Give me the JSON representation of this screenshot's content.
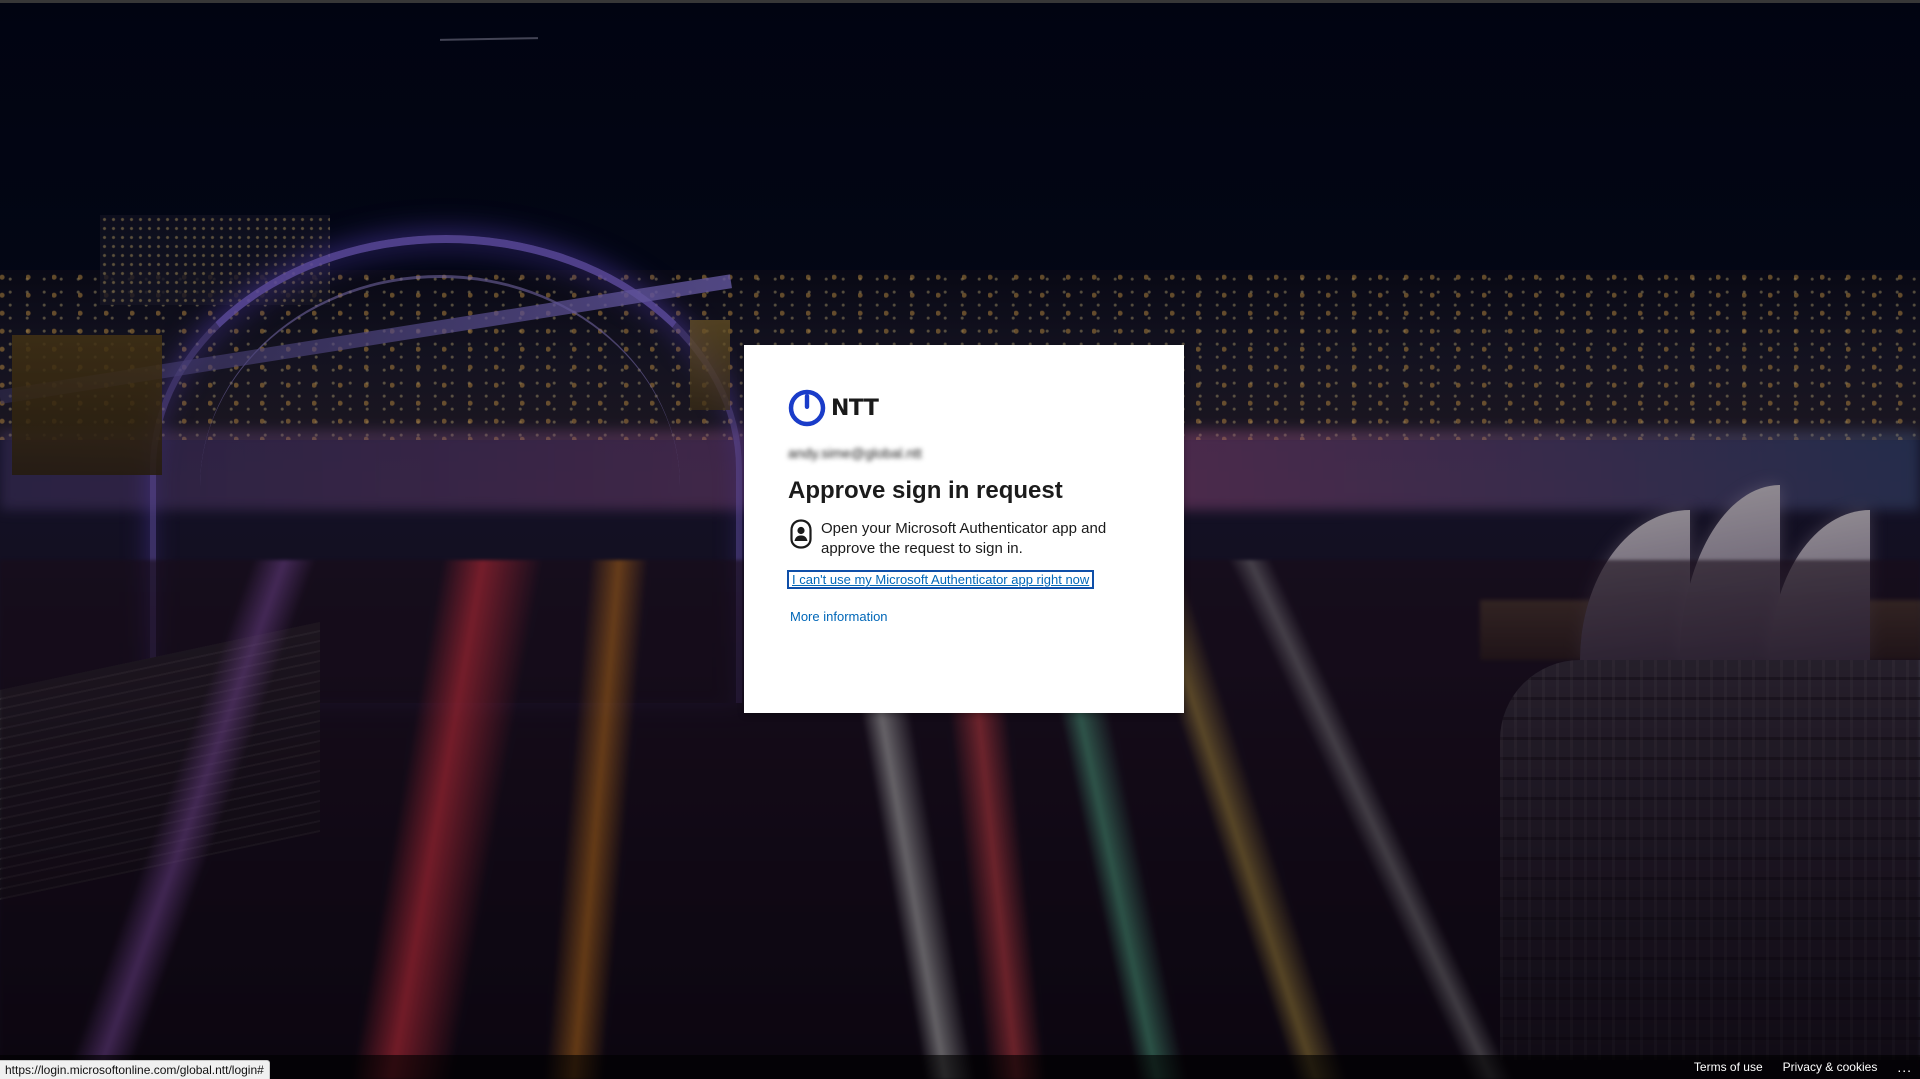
{
  "brand": {
    "wordmark": "NTT",
    "logo_color": "#1a3cc9"
  },
  "signin": {
    "identity": "andy.sime@global.ntt",
    "title": "Approve sign in request",
    "instruction": "Open your Microsoft Authenticator app and approve the request to sign in.",
    "cant_use_link": "I can't use my Microsoft Authenticator app right now",
    "more_info_link": "More information",
    "icon": "authenticator-lock-icon",
    "link_color": "#0067b8"
  },
  "footer": {
    "terms": "Terms of use",
    "privacy": "Privacy & cookies",
    "more": "...",
    "more_icon": "ellipsis-icon"
  },
  "status_bar": {
    "url": "https://login.microsoftonline.com/global.ntt/login#"
  }
}
